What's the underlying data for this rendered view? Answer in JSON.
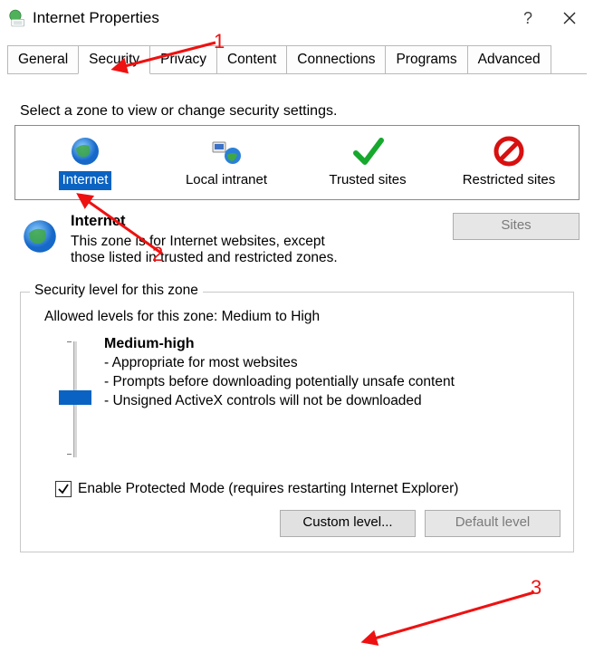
{
  "window": {
    "title": "Internet Properties"
  },
  "tabs": {
    "items": [
      {
        "label": "General"
      },
      {
        "label": "Security"
      },
      {
        "label": "Privacy"
      },
      {
        "label": "Content"
      },
      {
        "label": "Connections"
      },
      {
        "label": "Programs"
      },
      {
        "label": "Advanced"
      }
    ],
    "active_index": 1
  },
  "security": {
    "zone_prompt": "Select a zone to view or change security settings.",
    "zones": [
      {
        "label": "Internet",
        "icon": "globe-icon"
      },
      {
        "label": "Local intranet",
        "icon": "lan-globe-icon"
      },
      {
        "label": "Trusted sites",
        "icon": "checkmark-icon"
      },
      {
        "label": "Restricted sites",
        "icon": "prohibited-icon"
      }
    ],
    "selected_zone_index": 0,
    "zone_detail": {
      "title": "Internet",
      "desc": "This zone is for Internet websites, except those listed in trusted and restricted zones.",
      "sites_button": "Sites"
    },
    "fieldset_title": "Security level for this zone",
    "allowed_levels": "Allowed levels for this zone: Medium to High",
    "level": {
      "name": "Medium-high",
      "bullets": [
        "- Appropriate for most websites",
        "- Prompts before downloading potentially unsafe content",
        "- Unsigned ActiveX controls will not be downloaded"
      ]
    },
    "protected_checkbox": {
      "checked": true,
      "label": "Enable Protected Mode (requires restarting Internet Explorer)"
    },
    "buttons": {
      "custom": "Custom level...",
      "default": "Default level"
    }
  },
  "annotations": {
    "n1": "1",
    "n2": "2",
    "n3": "3"
  }
}
